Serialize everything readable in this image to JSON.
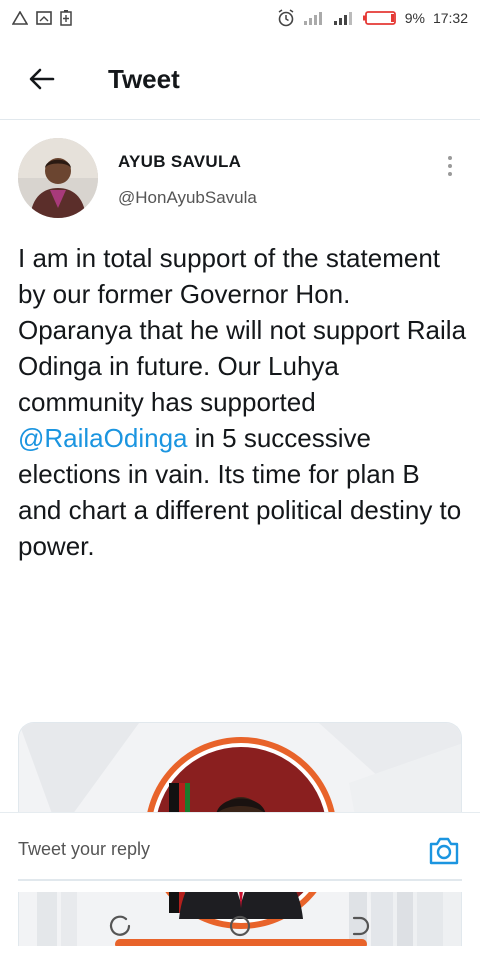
{
  "status_bar": {
    "battery_percent": "9%",
    "time": "17:32",
    "battery_color": "#e53935"
  },
  "header": {
    "title": "Tweet"
  },
  "tweet": {
    "display_name": "AYUB SAVULA",
    "handle": "@HonAyubSavula",
    "text_before": "I am in total support of the statement by our former Governor Hon. Oparanya that he will not support Raila Odinga in future. Our Luhya community has supported ",
    "mention": "@RailaOdinga",
    "text_after": " in 5 successive elections in vain. Its time for plan B and chart a different political destiny to power."
  },
  "reply": {
    "placeholder": "Tweet your reply"
  },
  "colors": {
    "accent": "#1b95e0",
    "frame_orange": "#e8632a",
    "divider": "#e1e8ed"
  },
  "icons": {
    "back": "arrow-left-icon",
    "more": "more-vertical-icon",
    "camera": "camera-icon",
    "nav_recent": "recent-apps-icon",
    "nav_home": "home-icon",
    "nav_back": "nav-back-icon"
  }
}
